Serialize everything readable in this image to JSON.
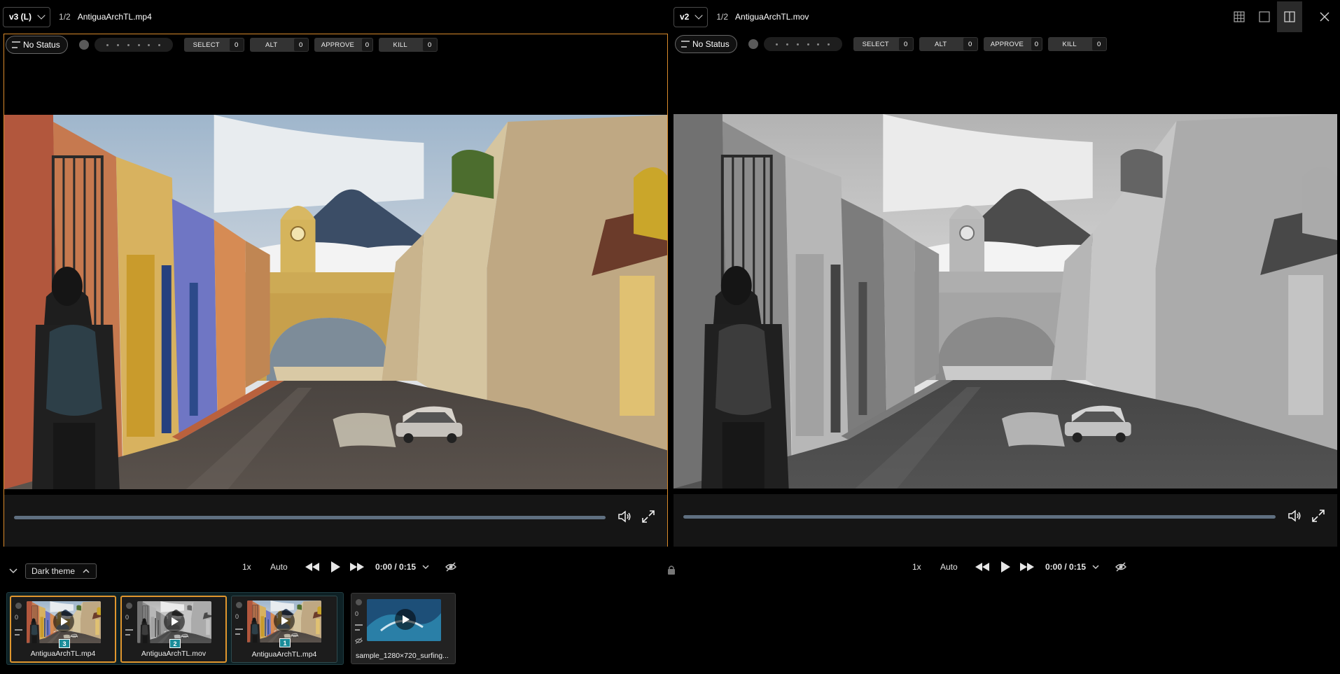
{
  "left_viewer": {
    "version": "v3 (L)",
    "page": "1/2",
    "file_name": "AntiguaArchTL.mp4",
    "status": "No Status",
    "tags": [
      {
        "label": "SELECT",
        "count": "0"
      },
      {
        "label": "ALT",
        "count": "0"
      },
      {
        "label": "APPROVE",
        "count": "0"
      },
      {
        "label": "KILL",
        "count": "0"
      }
    ],
    "progress": 0,
    "speed": "1x",
    "quality": "Auto",
    "time": "0:00 / 0:15"
  },
  "right_viewer": {
    "version": "v2",
    "page": "1/2",
    "file_name": "AntiguaArchTL.mov",
    "status": "No Status",
    "tags": [
      {
        "label": "SELECT",
        "count": "0"
      },
      {
        "label": "ALT",
        "count": "0"
      },
      {
        "label": "APPROVE",
        "count": "0"
      },
      {
        "label": "KILL",
        "count": "0"
      }
    ],
    "progress": 0,
    "speed": "1x",
    "quality": "Auto",
    "time": "0:00 / 0:15"
  },
  "top_tools": [
    "grid-view-icon",
    "single-view-icon",
    "split-view-icon",
    "close-icon"
  ],
  "theme": {
    "label": "Dark theme"
  },
  "colors": {
    "accent": "#d98a2b",
    "teal": "#1a8c99",
    "progress": "#5f6f80"
  },
  "filmstrip": {
    "items": [
      {
        "caption": "AntiguaArchTL.mp4",
        "badge": "3",
        "count": "0",
        "style": "color",
        "selected": true
      },
      {
        "caption": "AntiguaArchTL.mov",
        "badge": "2",
        "count": "0",
        "style": "gray",
        "selected": true
      },
      {
        "caption": "AntiguaArchTL.mp4",
        "badge": "1",
        "count": "0",
        "style": "color",
        "selected": false
      }
    ],
    "extra": {
      "caption": "sample_1280×720_surfing...",
      "count": "0"
    }
  }
}
